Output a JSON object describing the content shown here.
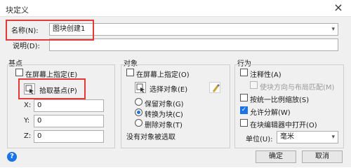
{
  "window": {
    "title": "块定义",
    "close": "×"
  },
  "name_field": {
    "label": "名称(N):",
    "value": "图块创建1"
  },
  "desc_field": {
    "label": "说明(D):",
    "value": ""
  },
  "basepoint": {
    "title": "基点",
    "specify_onscreen": "在屏幕上指定(E)",
    "pick_label": "拾取基点(P)",
    "x_label": "X:",
    "x_value": "0",
    "y_label": "Y:",
    "y_value": "0",
    "z_label": "Z:",
    "z_value": "0"
  },
  "objects": {
    "title": "对象",
    "specify_onscreen": "在屏幕上指定(O)",
    "select_label": "选择对象(E)",
    "retain": "保留对象(G)",
    "convert": "转换为块(C)",
    "delete": "删除对象(T)",
    "status": "没有对象被选取"
  },
  "behavior": {
    "title": "行为",
    "annotative": "注释性(A)",
    "match_orient": "使块方向与布局匹配(M)",
    "scale_uniform": "按统一比例缩放(S)",
    "allow_explode": "允许分解(W)",
    "open_editor": "在块编辑器中打开(O)",
    "unit_label": "单位(U):",
    "unit_value": "毫米"
  },
  "buttons": {
    "ok": "确定",
    "cancel": "取消",
    "help": "?"
  },
  "colors": {
    "highlight": "#e53935",
    "accent": "#1a73e8"
  }
}
